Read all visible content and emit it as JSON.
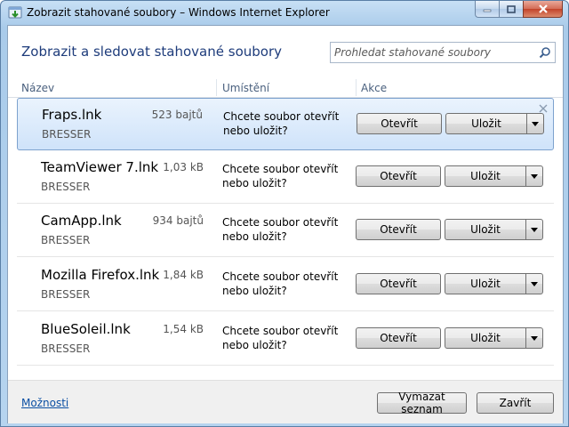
{
  "window": {
    "title": "Zobrazit stahované soubory – Windows Internet Explorer"
  },
  "header": {
    "title": "Zobrazit a sledovat stahované soubory",
    "search_placeholder": "Prohledat stahované soubory"
  },
  "columns": {
    "name": "Název",
    "location": "Umístění",
    "actions": "Akce"
  },
  "downloads": [
    {
      "name": "Fraps.lnk",
      "size": "523 bajtů",
      "source": "BRESSER",
      "message": "Chcete soubor otevřít nebo uložit?",
      "open_label": "Otevřít",
      "save_label": "Uložit",
      "selected": true
    },
    {
      "name": "TeamViewer 7.lnk",
      "size": "1,03 kB",
      "source": "BRESSER",
      "message": "Chcete soubor otevřít nebo uložit?",
      "open_label": "Otevřít",
      "save_label": "Uložit",
      "selected": false
    },
    {
      "name": "CamApp.lnk",
      "size": "934 bajtů",
      "source": "BRESSER",
      "message": "Chcete soubor otevřít nebo uložit?",
      "open_label": "Otevřít",
      "save_label": "Uložit",
      "selected": false
    },
    {
      "name": "Mozilla Firefox.lnk",
      "size": "1,84 kB",
      "source": "BRESSER",
      "message": "Chcete soubor otevřít nebo uložit?",
      "open_label": "Otevřít",
      "save_label": "Uložit",
      "selected": false
    },
    {
      "name": "BlueSoleil.lnk",
      "size": "1,54 kB",
      "source": "BRESSER",
      "message": "Chcete soubor otevřít nebo uložit?",
      "open_label": "Otevřít",
      "save_label": "Uložit",
      "selected": false
    }
  ],
  "footer": {
    "options_label": "Možnosti",
    "clear_label": "Vymazat seznam",
    "close_label": "Zavřít"
  },
  "colors": {
    "header_title": "#1e3c7b",
    "link": "#0b4fa3",
    "selected_row": "#cfe3fa"
  }
}
